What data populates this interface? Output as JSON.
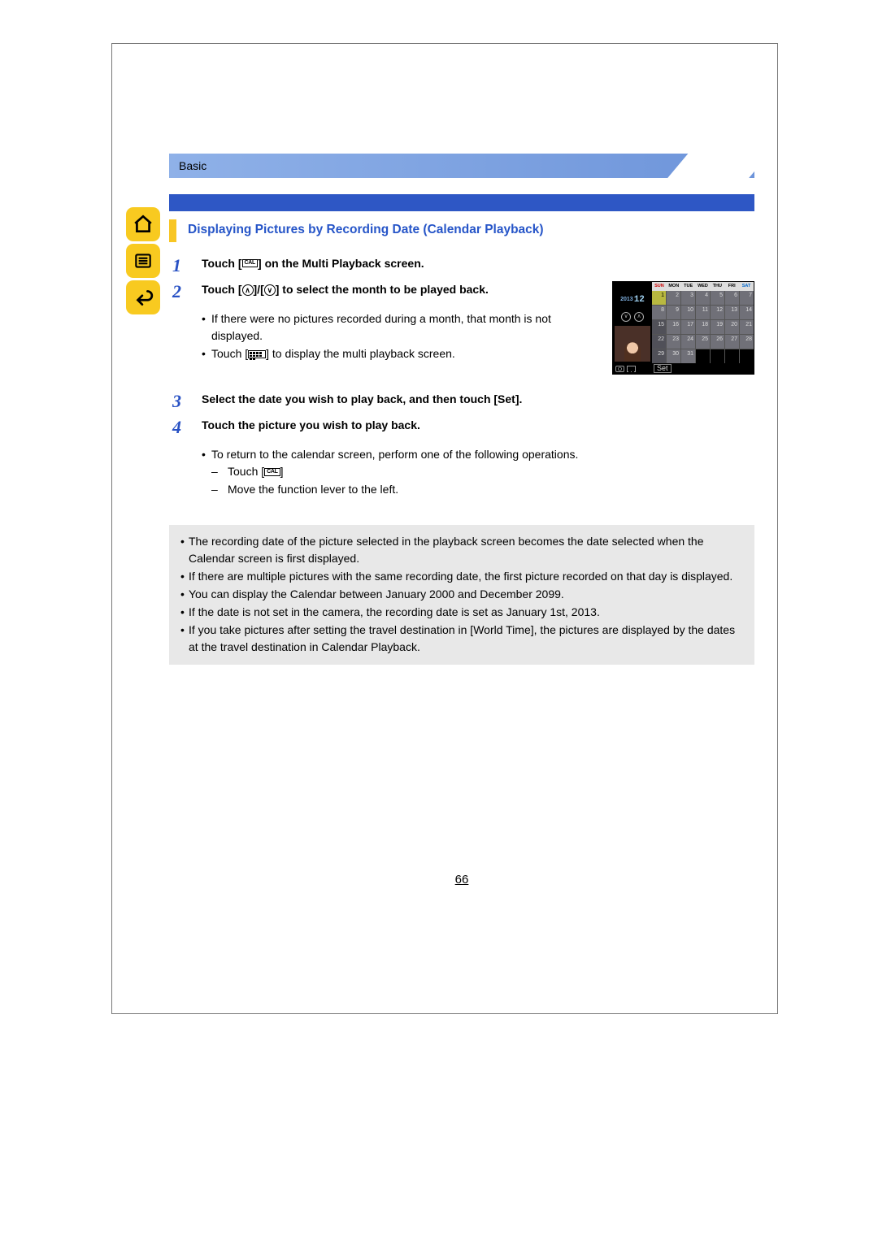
{
  "header": {
    "category": "Basic"
  },
  "section_title": "Displaying Pictures by Recording Date (Calendar Playback)",
  "icons": {
    "cal": "CAL"
  },
  "steps": [
    {
      "num": "1",
      "title_before": "Touch [",
      "title_after": "] on the Multi Playback screen."
    },
    {
      "num": "2",
      "title_before": "Touch [",
      "title_mid": "]/[",
      "title_after": "] to select the month to be played back.",
      "sub": [
        "If there were no pictures recorded during a month, that month is not displayed.",
        "Touch [    ] to display the multi playback screen."
      ]
    },
    {
      "num": "3",
      "title": "Select the date you wish to play back, and then touch [Set]."
    },
    {
      "num": "4",
      "title": "Touch the picture you wish to play back.",
      "sub_intro": "To return to the calendar screen, perform one of the following operations.",
      "sub": [
        "Touch [     ]",
        "Move the function lever to the left."
      ]
    }
  ],
  "calendar": {
    "year": "2013",
    "month": "12",
    "days": [
      "SUN",
      "MON",
      "TUE",
      "WED",
      "THU",
      "FRI",
      "SAT"
    ],
    "cells": [
      [
        {
          "t": "1",
          "hl": true
        },
        {
          "t": "2"
        },
        {
          "t": "3"
        },
        {
          "t": "4"
        },
        {
          "t": "5"
        },
        {
          "t": "6"
        },
        {
          "t": "7"
        }
      ],
      [
        {
          "t": "8"
        },
        {
          "t": "9"
        },
        {
          "t": "10"
        },
        {
          "t": "11"
        },
        {
          "t": "12"
        },
        {
          "t": "13"
        },
        {
          "t": "14"
        }
      ],
      [
        {
          "t": "15",
          "dk": true
        },
        {
          "t": "16"
        },
        {
          "t": "17"
        },
        {
          "t": "18"
        },
        {
          "t": "19"
        },
        {
          "t": "20"
        },
        {
          "t": "21"
        }
      ],
      [
        {
          "t": "22",
          "dk": true
        },
        {
          "t": "23"
        },
        {
          "t": "24"
        },
        {
          "t": "25"
        },
        {
          "t": "26"
        },
        {
          "t": "27"
        },
        {
          "t": "28"
        }
      ],
      [
        {
          "t": "29",
          "dk": true
        },
        {
          "t": "30"
        },
        {
          "t": "31"
        },
        {
          "t": "",
          "e": true
        },
        {
          "t": "",
          "e": true
        },
        {
          "t": "",
          "e": true
        },
        {
          "t": "",
          "e": true
        }
      ]
    ],
    "set": "Set"
  },
  "notes": [
    "The recording date of the picture selected in the playback screen becomes the date selected when the Calendar screen is first displayed.",
    "If there are multiple pictures with the same recording date, the first picture recorded on that day is displayed.",
    "You can display the Calendar between January 2000 and December 2099.",
    "If the date is not set in the camera, the recording date is set as January 1st, 2013.",
    "If you take pictures after setting the travel destination in [World Time], the pictures are displayed by the dates at the travel destination in Calendar Playback."
  ],
  "page_number": "66"
}
